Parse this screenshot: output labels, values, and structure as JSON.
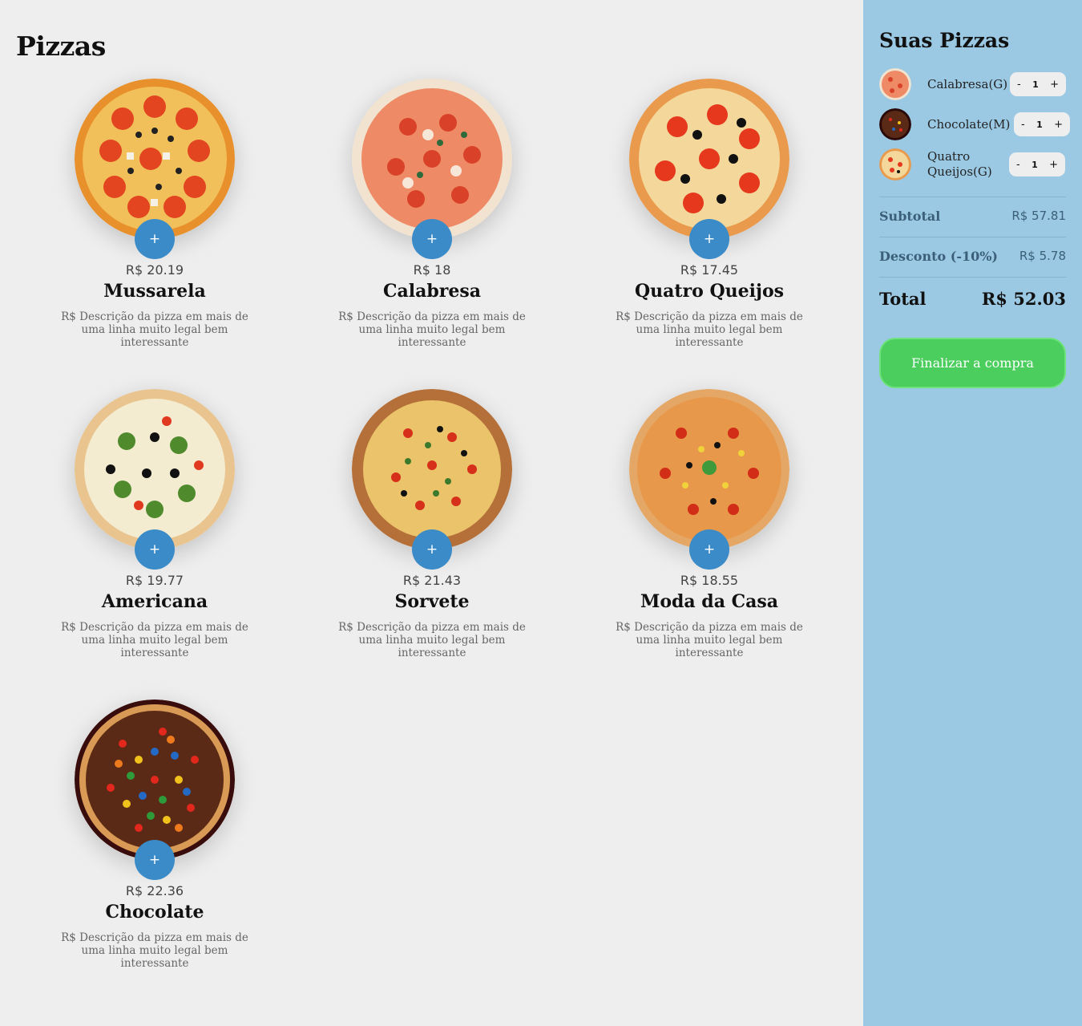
{
  "page_title": "Pizzas",
  "pizzas": [
    {
      "price": "R$ 20.19",
      "name": "Mussarela",
      "description": "R$ Descrição da pizza em mais de uma linha muito legal bem interessante",
      "add_label": "+"
    },
    {
      "price": "R$ 18",
      "name": "Calabresa",
      "description": "R$ Descrição da pizza em mais de uma linha muito legal bem interessante",
      "add_label": "+"
    },
    {
      "price": "R$ 17.45",
      "name": "Quatro Queijos",
      "description": "R$ Descrição da pizza em mais de uma linha muito legal bem interessante",
      "add_label": "+"
    },
    {
      "price": "R$ 19.77",
      "name": "Americana",
      "description": "R$ Descrição da pizza em mais de uma linha muito legal bem interessante",
      "add_label": "+"
    },
    {
      "price": "R$ 21.43",
      "name": "Sorvete",
      "description": "R$ Descrição da pizza em mais de uma linha muito legal bem interessante",
      "add_label": "+"
    },
    {
      "price": "R$ 18.55",
      "name": "Moda da Casa",
      "description": "R$ Descrição da pizza em mais de uma linha muito legal bem interessante",
      "add_label": "+"
    },
    {
      "price": "R$ 22.36",
      "name": "Chocolate",
      "description": "R$ Descrição da pizza em mais de uma linha muito legal bem interessante",
      "add_label": "+"
    }
  ],
  "cart": {
    "title": "Suas Pizzas",
    "items": [
      {
        "name": "Calabresa(G)",
        "qty": "1",
        "minus": "-",
        "plus": "+"
      },
      {
        "name": "Chocolate(M)",
        "qty": "1",
        "minus": "-",
        "plus": "+"
      },
      {
        "name": "Quatro Queijos(G)",
        "qty": "1",
        "minus": "-",
        "plus": "+"
      }
    ],
    "subtotal_label": "Subtotal",
    "subtotal_value": "R$ 57.81",
    "discount_label": "Desconto (-10%)",
    "discount_value": "R$ 5.78",
    "total_label": "Total",
    "total_value": "R$ 52.03",
    "checkout_label": "Finalizar a compra"
  },
  "colors": {
    "sidebar_bg": "#9bc9e4",
    "add_button": "#3a8bc8",
    "checkout_button": "#4bce5e"
  }
}
